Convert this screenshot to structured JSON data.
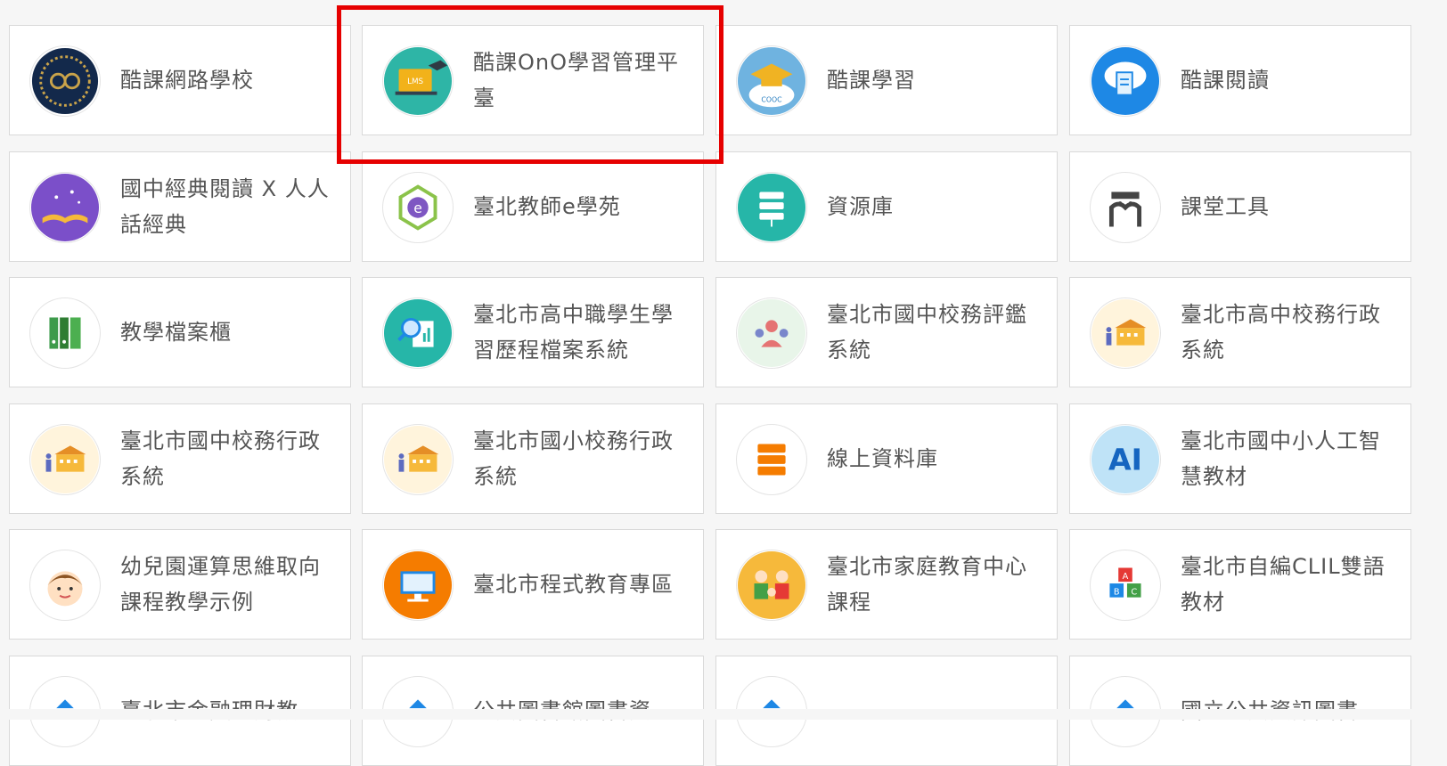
{
  "accent_colors": {
    "highlight_border": "#e60000",
    "card_text": "#555555"
  },
  "cards": [
    {
      "label": "酷課網路學校",
      "icon": "cooc-school-emblem-icon"
    },
    {
      "label": "酷課OnO學習管理平臺",
      "icon": "lms-laptop-icon"
    },
    {
      "label": "酷課學習",
      "icon": "cooc-graduation-cloud-icon"
    },
    {
      "label": "酷課閱讀",
      "icon": "cloud-reading-icon"
    },
    {
      "label": "國中經典閱讀 X 人人話經典",
      "icon": "open-book-stars-icon"
    },
    {
      "label": "臺北教師e學苑",
      "icon": "e-learning-hexagon-icon"
    },
    {
      "label": "資源庫",
      "icon": "server-stack-icon"
    },
    {
      "label": "課堂工具",
      "icon": "classroom-mascot-icon"
    },
    {
      "label": "教學檔案櫃",
      "icon": "binder-folders-icon"
    },
    {
      "label": "臺北市高中職學生學習歷程檔案系統",
      "icon": "magnifier-report-icon"
    },
    {
      "label": "臺北市國中校務評鑑系統",
      "icon": "people-group-icon"
    },
    {
      "label": "臺北市高中校務行政系統",
      "icon": "school-building-icon"
    },
    {
      "label": "臺北市國中校務行政系統",
      "icon": "school-building-icon"
    },
    {
      "label": "臺北市國小校務行政系統",
      "icon": "school-building-icon"
    },
    {
      "label": "線上資料庫",
      "icon": "database-stack-icon"
    },
    {
      "label": "臺北市國中小人工智慧教材",
      "icon": "ai-letters-icon"
    },
    {
      "label": "幼兒園運算思維取向課程教學示例",
      "icon": "child-face-icon"
    },
    {
      "label": "臺北市程式教育專區",
      "icon": "computer-monitor-icon"
    },
    {
      "label": "臺北市家庭教育中心課程",
      "icon": "family-icon"
    },
    {
      "label": "臺北市自編CLIL雙語教材",
      "icon": "abc-blocks-icon"
    },
    {
      "label": "臺北市金融理財教",
      "icon": "partial-icon"
    },
    {
      "label": "公共圖書館圖書資",
      "icon": "partial-icon"
    },
    {
      "label": "",
      "icon": "partial-icon"
    },
    {
      "label": "國立公共資訊圖書",
      "icon": "partial-icon"
    }
  ]
}
